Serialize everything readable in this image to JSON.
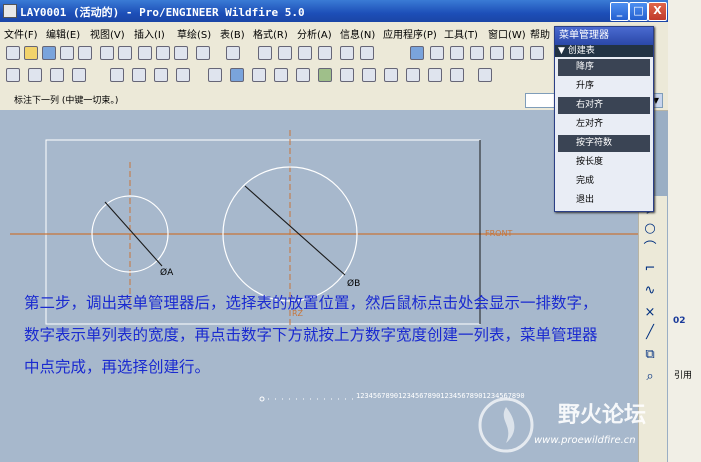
{
  "window": {
    "title": "LAY0001 (活动的) - Pro/ENGINEER Wildfire 5.0",
    "min_label": "_",
    "max_label": "□",
    "close_label": "X"
  },
  "menu": [
    "文件(F)",
    "编辑(E)",
    "视图(V)",
    "插入(I)",
    "草绘(S)",
    "表(B)",
    "格式(R)",
    "分析(A)",
    "信息(N)",
    "应用程序(P)",
    "工具(T)",
    "窗口(W)",
    "帮助"
  ],
  "message": "标注下一列 (中键一切束。)",
  "menu_manager": {
    "title": "菜单管理器",
    "submenu": "创建表",
    "items": [
      {
        "label": "降序",
        "selected": true
      },
      {
        "label": "升序",
        "selected": false
      },
      {
        "label": "右对齐",
        "selected": true
      },
      {
        "label": "左对齐",
        "selected": false
      },
      {
        "label": "按字符数",
        "selected": true
      },
      {
        "label": "按长度",
        "selected": false
      },
      {
        "label": "完成",
        "selected": false
      },
      {
        "label": "退出",
        "selected": false
      }
    ]
  },
  "drawing": {
    "label_a": "ØA",
    "label_b": "ØB",
    "label_front": "FRONT",
    "label_rz": "RZ",
    "numbers": "1234567890123456789012345678901234567890"
  },
  "instruction": "第二步，调出菜单管理器后，选择表的放置位置，然后鼠标点击处会显示一排数字，数字表示单列表的宽度，再点击数字下方就按上方数字宽度创建一列表，菜单管理器中点完成，再选择创建行。",
  "watermark": {
    "title": "野火论坛",
    "url": "www.proewildfire.cn"
  },
  "right_panel": {
    "item1": "引用",
    "item2": "02"
  },
  "colors": {
    "canvas": "#a7b8cc",
    "titlebar": "#1d4fb8",
    "instruction": "#1a2ad0"
  }
}
